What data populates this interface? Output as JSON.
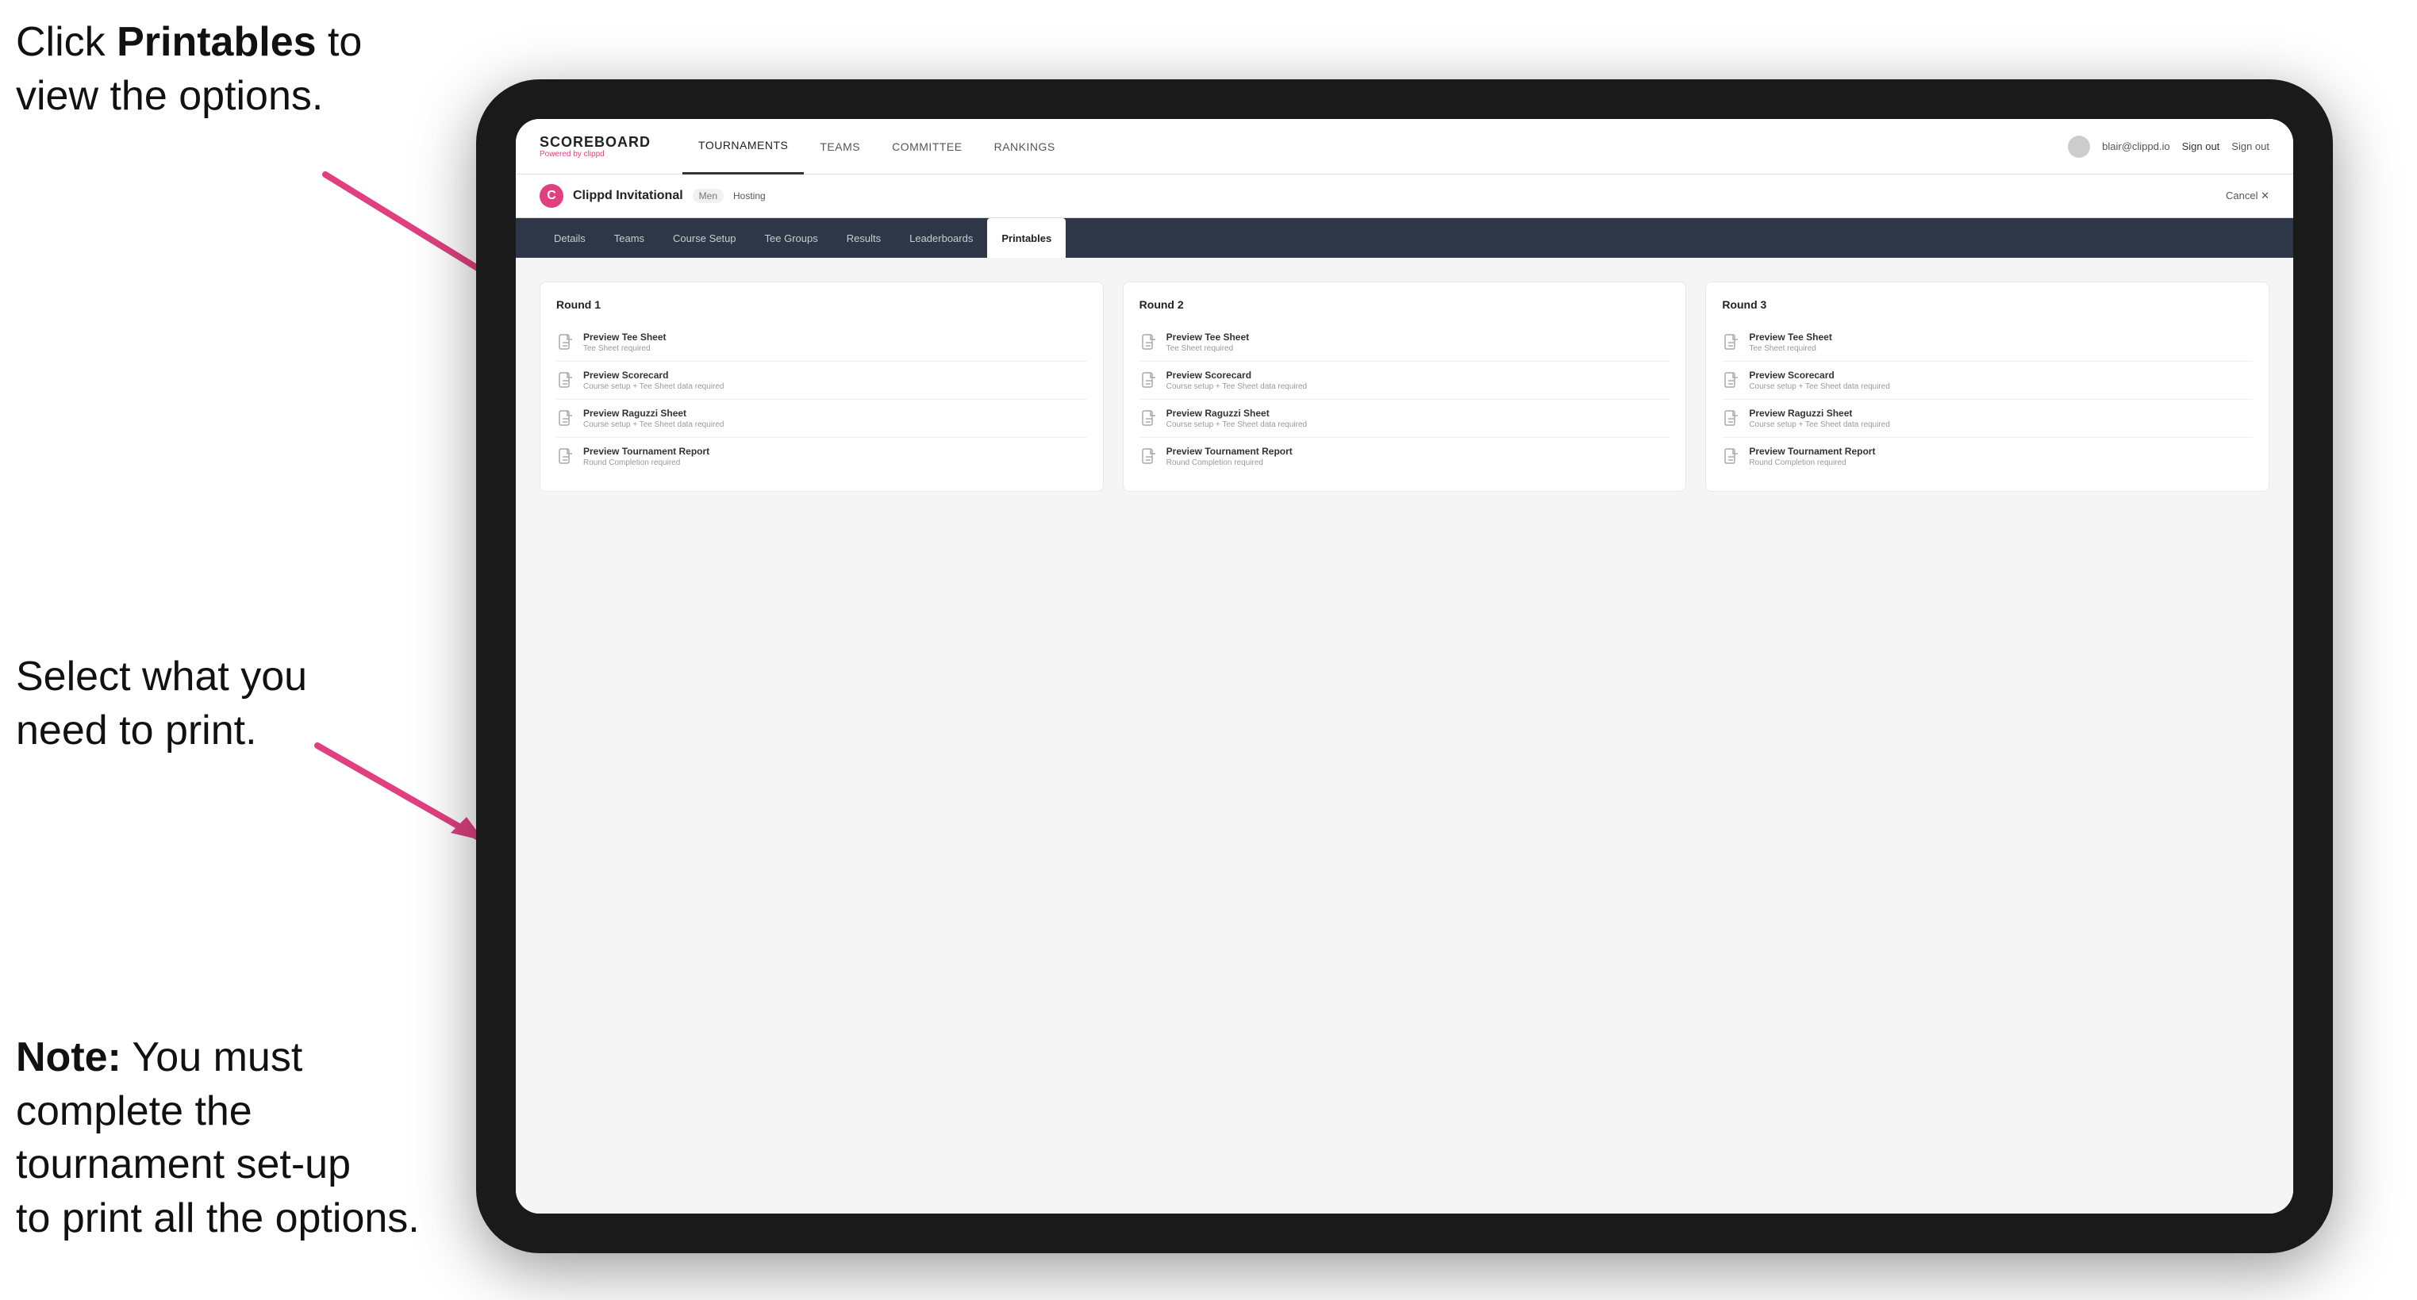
{
  "annotations": {
    "top": {
      "line1": "Click ",
      "bold": "Printables",
      "line2": " to",
      "line3": "view the options."
    },
    "middle": "Select what you\nneed to print.",
    "bottom": {
      "bold_prefix": "Note:",
      "text": " You must\ncomplete the\ntournament set-up\nto print all the options."
    }
  },
  "nav": {
    "brand": "SCOREBOARD",
    "brand_sub": "Powered by clippd",
    "items": [
      "TOURNAMENTS",
      "TEAMS",
      "COMMITTEE",
      "RANKINGS"
    ],
    "active_index": 0,
    "user_email": "blair@clippd.io",
    "sign_out": "Sign out"
  },
  "tournament": {
    "logo_letter": "C",
    "name": "Clippd Invitational",
    "badge": "Men",
    "status": "Hosting",
    "cancel_label": "Cancel ✕"
  },
  "sub_nav": {
    "items": [
      "Details",
      "Teams",
      "Course Setup",
      "Tee Groups",
      "Results",
      "Leaderboards",
      "Printables"
    ],
    "active": "Printables"
  },
  "rounds": [
    {
      "title": "Round 1",
      "items": [
        {
          "title": "Preview Tee Sheet",
          "subtitle": "Tee Sheet required"
        },
        {
          "title": "Preview Scorecard",
          "subtitle": "Course setup + Tee Sheet data required"
        },
        {
          "title": "Preview Raguzzi Sheet",
          "subtitle": "Course setup + Tee Sheet data required"
        },
        {
          "title": "Preview Tournament Report",
          "subtitle": "Round Completion required"
        }
      ]
    },
    {
      "title": "Round 2",
      "items": [
        {
          "title": "Preview Tee Sheet",
          "subtitle": "Tee Sheet required"
        },
        {
          "title": "Preview Scorecard",
          "subtitle": "Course setup + Tee Sheet data required"
        },
        {
          "title": "Preview Raguzzi Sheet",
          "subtitle": "Course setup + Tee Sheet data required"
        },
        {
          "title": "Preview Tournament Report",
          "subtitle": "Round Completion required"
        }
      ]
    },
    {
      "title": "Round 3",
      "items": [
        {
          "title": "Preview Tee Sheet",
          "subtitle": "Tee Sheet required"
        },
        {
          "title": "Preview Scorecard",
          "subtitle": "Course setup + Tee Sheet data required"
        },
        {
          "title": "Preview Raguzzi Sheet",
          "subtitle": "Course setup + Tee Sheet data required"
        },
        {
          "title": "Preview Tournament Report",
          "subtitle": "Round Completion required"
        }
      ]
    }
  ]
}
